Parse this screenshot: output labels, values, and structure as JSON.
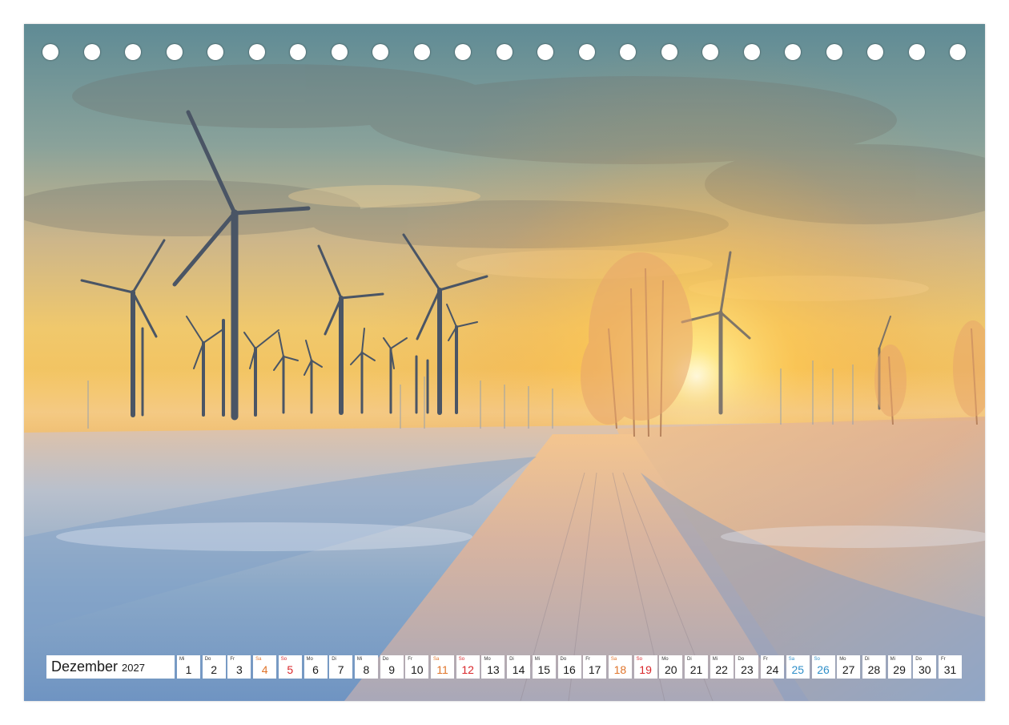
{
  "calendar": {
    "month": "Dezember",
    "year": "2027",
    "hole_count": 23,
    "colors": {
      "saturday": "#e0742a",
      "sunday": "#d9262a",
      "highlight_weekend": "#2f8fc9"
    },
    "days": [
      {
        "wd": "Mi",
        "n": "1",
        "type": "weekday"
      },
      {
        "wd": "Do",
        "n": "2",
        "type": "weekday"
      },
      {
        "wd": "Fr",
        "n": "3",
        "type": "weekday"
      },
      {
        "wd": "Sa",
        "n": "4",
        "type": "sat"
      },
      {
        "wd": "So",
        "n": "5",
        "type": "sun"
      },
      {
        "wd": "Mo",
        "n": "6",
        "type": "weekday"
      },
      {
        "wd": "Di",
        "n": "7",
        "type": "weekday"
      },
      {
        "wd": "Mi",
        "n": "8",
        "type": "weekday"
      },
      {
        "wd": "Do",
        "n": "9",
        "type": "weekday"
      },
      {
        "wd": "Fr",
        "n": "10",
        "type": "weekday"
      },
      {
        "wd": "Sa",
        "n": "11",
        "type": "sat"
      },
      {
        "wd": "So",
        "n": "12",
        "type": "sun"
      },
      {
        "wd": "Mo",
        "n": "13",
        "type": "weekday"
      },
      {
        "wd": "Di",
        "n": "14",
        "type": "weekday"
      },
      {
        "wd": "Mi",
        "n": "15",
        "type": "weekday"
      },
      {
        "wd": "Do",
        "n": "16",
        "type": "weekday"
      },
      {
        "wd": "Fr",
        "n": "17",
        "type": "weekday"
      },
      {
        "wd": "Sa",
        "n": "18",
        "type": "sat"
      },
      {
        "wd": "So",
        "n": "19",
        "type": "sun"
      },
      {
        "wd": "Mo",
        "n": "20",
        "type": "weekday"
      },
      {
        "wd": "Di",
        "n": "21",
        "type": "weekday"
      },
      {
        "wd": "Mi",
        "n": "22",
        "type": "weekday"
      },
      {
        "wd": "Do",
        "n": "23",
        "type": "weekday"
      },
      {
        "wd": "Fr",
        "n": "24",
        "type": "weekday"
      },
      {
        "wd": "Sa",
        "n": "25",
        "type": "sat",
        "blue": true
      },
      {
        "wd": "So",
        "n": "26",
        "type": "sun",
        "blue": true
      },
      {
        "wd": "Mo",
        "n": "27",
        "type": "weekday"
      },
      {
        "wd": "Di",
        "n": "28",
        "type": "weekday"
      },
      {
        "wd": "Mi",
        "n": "29",
        "type": "weekday"
      },
      {
        "wd": "Do",
        "n": "30",
        "type": "weekday"
      },
      {
        "wd": "Fr",
        "n": "31",
        "type": "weekday"
      }
    ]
  }
}
